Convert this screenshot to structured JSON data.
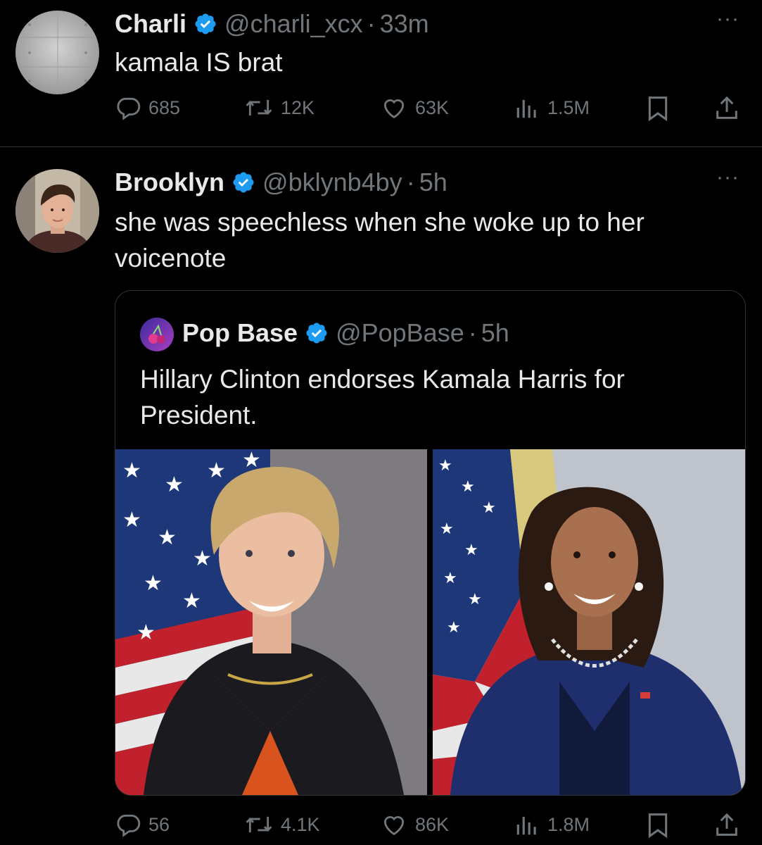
{
  "tweet1": {
    "name": "Charli",
    "handle": "@charli_xcx",
    "separator": "·",
    "time": "33m",
    "text": "kamala IS brat",
    "stats": {
      "replies": "685",
      "reposts": "12K",
      "likes": "63K",
      "views": "1.5M"
    }
  },
  "tweet2": {
    "name": "Brooklyn",
    "handle": "@bklynb4by",
    "separator": "·",
    "time": "5h",
    "text": "she was speechless when she woke up to her voicenote",
    "quote": {
      "name": "Pop Base",
      "handle": "@PopBase",
      "separator": "·",
      "time": "5h",
      "text": "Hillary Clinton endorses Kamala Harris for President."
    },
    "stats": {
      "replies": "56",
      "reposts": "4.1K",
      "likes": "86K",
      "views": "1.8M"
    }
  },
  "colors": {
    "background": "#000000",
    "text": "#e7e9ea",
    "muted": "#71767b",
    "verified": "#1d9bf0",
    "divider": "#2f3336"
  },
  "icons": [
    "verified-badge-icon",
    "more-icon",
    "reply-icon",
    "repost-icon",
    "like-icon",
    "views-icon",
    "bookmark-icon",
    "share-icon"
  ]
}
